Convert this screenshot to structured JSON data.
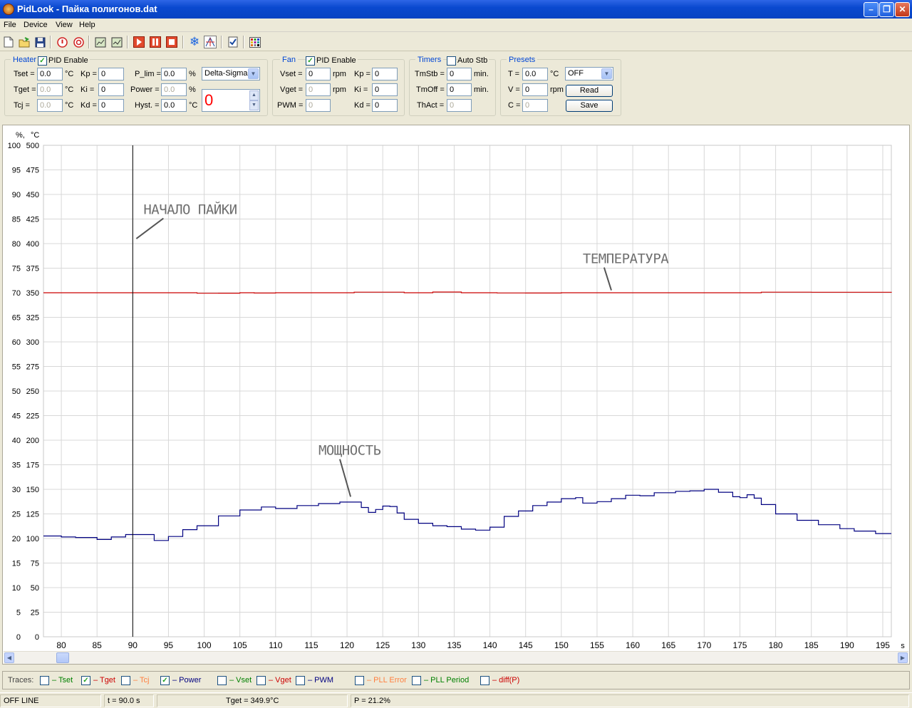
{
  "window": {
    "title": "PidLook - Пайка полигонов.dat"
  },
  "menu": [
    "File",
    "Device",
    "View",
    "Help"
  ],
  "heater": {
    "title": "Heater",
    "pid_enable": "PID Enable",
    "tset_label": "Tset =",
    "tset": "0.0",
    "tget_label": "Tget =",
    "tget": "0.0",
    "tcj_label": "Tcj =",
    "tcj": "0.0",
    "unit_c": "°C",
    "kp_label": "Kp =",
    "kp": "0",
    "ki_label": "Ki =",
    "ki": "0",
    "kd_label": "Kd =",
    "kd": "0",
    "plim_label": "P_lim =",
    "plim": "0.0",
    "power_label": "Power =",
    "power": "0.0",
    "hyst_label": "Hyst. =",
    "hyst": "0.0",
    "unit_pct": "%",
    "mode": "Delta-Sigma",
    "counter": "0"
  },
  "fan": {
    "title": "Fan",
    "pid_enable": "PID Enable",
    "vset_label": "Vset =",
    "vset": "0",
    "vget_label": "Vget =",
    "vget": "0",
    "pwm_label": "PWM =",
    "pwm": "0",
    "unit_rpm": "rpm",
    "kp_label": "Kp =",
    "kp": "0",
    "ki_label": "Ki =",
    "ki": "0",
    "kd_label": "Kd =",
    "kd": "0"
  },
  "timers": {
    "title": "Timers",
    "auto_stb": "Auto Stb",
    "tmstb_label": "TmStb =",
    "tmstb": "0",
    "tmoff_label": "TmOff =",
    "tmoff": "0",
    "thact_label": "ThAct =",
    "thact": "0",
    "unit_min": "min."
  },
  "presets": {
    "title": "Presets",
    "t_label": "T =",
    "t": "0.0",
    "unit_c": "°C",
    "v_label": "V =",
    "v": "0",
    "unit_rpm": "rpm",
    "c_label": "C =",
    "c": "0",
    "preset": "OFF",
    "read": "Read",
    "save": "Save"
  },
  "chart_data": {
    "type": "line",
    "ylabel_left": "%,",
    "ylabel_right": "°C",
    "xlabel": "s",
    "xlim": [
      77.5,
      196.2
    ],
    "x_ticks": [
      80,
      85,
      90,
      95,
      100,
      105,
      110,
      115,
      120,
      125,
      130,
      135,
      140,
      145,
      150,
      155,
      160,
      165,
      170,
      175,
      180,
      185,
      190,
      195
    ],
    "y_ticks_pct": [
      0,
      5,
      10,
      15,
      20,
      25,
      30,
      35,
      40,
      45,
      50,
      55,
      60,
      65,
      70,
      75,
      80,
      85,
      90,
      95,
      100
    ],
    "y_ticks_temp": [
      0,
      25,
      50,
      75,
      100,
      125,
      150,
      175,
      200,
      225,
      250,
      275,
      300,
      325,
      350,
      375,
      400,
      425,
      450,
      475,
      500
    ],
    "ylim_pct": [
      0,
      100
    ],
    "ylim_temp": [
      0,
      500
    ],
    "cursor_x": 90,
    "annotations": [
      {
        "text": "НАЧАЛО ПАЙКИ",
        "x": 91.5,
        "y_pct": 86,
        "to_x": 90.5,
        "to_y_pct": 81
      },
      {
        "text": "ТЕМПЕРАТУРА",
        "x": 153,
        "y_pct": 76,
        "to_x": 157,
        "to_y_pct": 70.5
      },
      {
        "text": "МОЩНОСТЬ",
        "x": 116,
        "y_pct": 37,
        "to_x": 120.5,
        "to_y_pct": 28.5
      }
    ],
    "series": [
      {
        "name": "Tget",
        "color": "#cc0000",
        "unit": "°C",
        "x": [
          77.5,
          97,
          99,
          102,
          105,
          107,
          110,
          119,
          121,
          128,
          132,
          136,
          141,
          145,
          150,
          160,
          170,
          176,
          178,
          185,
          196.2
        ],
        "y": [
          350,
          350,
          349.5,
          349.6,
          350,
          349.7,
          350,
          350,
          350.6,
          350,
          350.7,
          350,
          349.8,
          349.7,
          350,
          350,
          350,
          350,
          350.6,
          350.5,
          350
        ]
      },
      {
        "name": "Power",
        "color": "#000080",
        "unit": "%",
        "x": [
          77.5,
          80,
          82,
          85,
          87,
          89,
          91,
          93,
          95,
          97,
          99,
          102,
          105,
          108,
          110,
          113,
          116,
          119,
          121,
          122,
          123,
          124,
          125,
          126,
          127,
          128,
          130,
          132,
          134,
          136,
          138,
          140,
          142,
          144,
          146,
          148,
          150,
          152,
          153,
          155,
          157,
          159,
          161,
          163,
          166,
          168,
          170,
          172,
          174,
          175,
          176,
          177,
          178,
          180,
          183,
          186,
          189,
          191,
          194,
          196.2
        ],
        "y": [
          20.5,
          20.3,
          20.2,
          19.8,
          20.3,
          20.8,
          20.8,
          19.6,
          20.4,
          21.8,
          22.6,
          24.6,
          25.8,
          26.4,
          26.1,
          26.7,
          27.1,
          27.4,
          27.4,
          26.3,
          25.3,
          25.9,
          26.6,
          26.5,
          25.2,
          23.9,
          23.1,
          22.6,
          22.4,
          21.9,
          21.7,
          22.3,
          24.5,
          25.6,
          26.7,
          27.4,
          28.1,
          28.3,
          27.2,
          27.5,
          28.1,
          28.8,
          28.7,
          29.3,
          29.6,
          29.7,
          30,
          29.4,
          28.5,
          28.3,
          28.9,
          28.2,
          26.9,
          25,
          23.7,
          22.8,
          22,
          21.5,
          21,
          21
        ]
      }
    ]
  },
  "traces": {
    "label": "Traces:",
    "items": [
      {
        "name": "Tset",
        "checked": false,
        "color": "#008000"
      },
      {
        "name": "Tget",
        "checked": true,
        "color": "#cc0000"
      },
      {
        "name": "Tcj",
        "checked": false,
        "color": "#ff8040"
      },
      {
        "name": "Power",
        "checked": true,
        "color": "#000080"
      },
      {
        "name": "Vset",
        "checked": false,
        "color": "#008000"
      },
      {
        "name": "Vget",
        "checked": false,
        "color": "#cc0000"
      },
      {
        "name": "PWM",
        "checked": false,
        "color": "#000080"
      },
      {
        "name": "PLL Error",
        "checked": false,
        "color": "#ff8040"
      },
      {
        "name": "PLL Period",
        "checked": false,
        "color": "#008000"
      },
      {
        "name": "diff(P)",
        "checked": false,
        "color": "#cc0000"
      }
    ]
  },
  "status": {
    "mode": "OFF LINE",
    "t": "t = 90.0 s",
    "tget": "Tget = 349.9°C",
    "p": "P = 21.2%"
  }
}
